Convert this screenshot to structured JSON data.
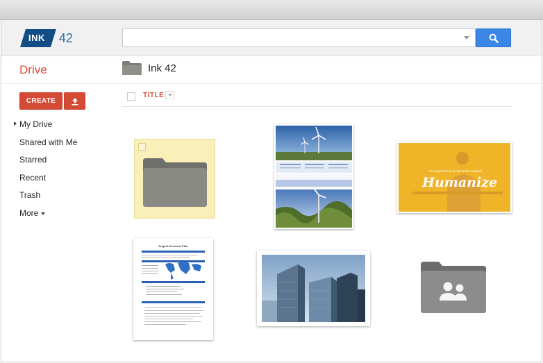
{
  "logo": {
    "badge": "INK",
    "number": "42"
  },
  "search": {
    "value": "",
    "placeholder": ""
  },
  "app_title": "Drive",
  "breadcrumb": {
    "folder_name": "Ink 42"
  },
  "sidebar": {
    "create_label": "CREATE",
    "items": [
      {
        "label": "My Drive",
        "active": true
      },
      {
        "label": "Shared with Me"
      },
      {
        "label": "Starred"
      },
      {
        "label": "Recent"
      },
      {
        "label": "Trash"
      },
      {
        "label": "More"
      }
    ]
  },
  "list": {
    "title_column": "TITLE"
  },
  "presentation": {
    "title_text": "Humanize",
    "subtitle_text": "Our approach to social media analysis"
  },
  "document": {
    "heading": "Project Overview Plan"
  },
  "colors": {
    "brand_red": "#dd4b39",
    "logo_blue": "#124d86",
    "search_blue": "#3b87e8",
    "presentation_yellow": "#f0b429",
    "selected_highlight": "#fbefb9",
    "folder_gray": "#8a8a85"
  },
  "icons": [
    "search-icon",
    "upload-icon",
    "folder-icon",
    "shared-folder-icon",
    "chevron-down-icon"
  ]
}
